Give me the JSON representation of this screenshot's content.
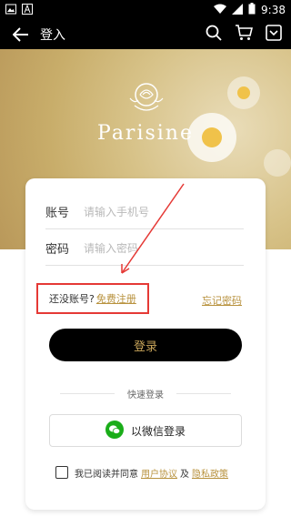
{
  "status_bar": {
    "time": "9:38"
  },
  "app_bar": {
    "title": "登入"
  },
  "hero": {
    "brand": "Parisine"
  },
  "form": {
    "account_label": "账号",
    "account_placeholder": "请输入手机号",
    "password_label": "密码",
    "password_placeholder": "请输入密码",
    "no_account_text": "还没账号?",
    "register_link": "免费注册",
    "forgot_link": "忘记密码",
    "login_button": "登录",
    "quick_login_label": "快速登录",
    "wechat_button": "以微信登录"
  },
  "agreement": {
    "prefix": "我已阅读并同意",
    "user_agreement": "用户协议",
    "and": "及",
    "privacy_policy": "隐私政策"
  },
  "colors": {
    "accent": "#b8923e",
    "button_bg": "#000000",
    "highlight_border": "#e53935",
    "wechat_green": "#1aad19"
  }
}
